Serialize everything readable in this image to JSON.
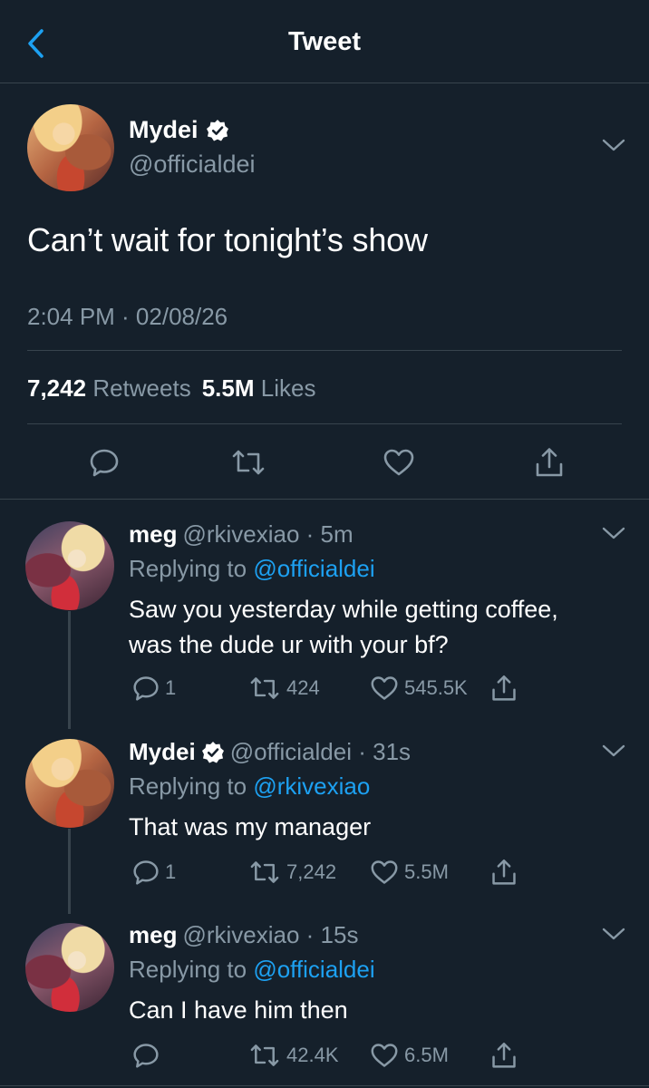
{
  "header": {
    "title": "Tweet"
  },
  "main_tweet": {
    "name": "Mydei",
    "handle": "@officialdei",
    "text": "Can’t wait for tonight’s show",
    "timestamp": "2:04 PM · 02/08/26",
    "retweets_count": "7,242",
    "retweets_label": "Retweets",
    "likes_count": "5.5M",
    "likes_label": "Likes"
  },
  "replies": [
    {
      "name": "meg",
      "meta": "@rkivexiao · 5m",
      "replying_prefix": "Replying to",
      "replying_to": "@officialdei",
      "text_lines": [
        "Saw you yesterday while getting coffee,",
        "was the dude ur with your bf?"
      ],
      "reply_count": "1",
      "retweet_count": "424",
      "like_count": "545.5K"
    },
    {
      "name": "Mydei",
      "meta": "@officialdei · 31s",
      "replying_prefix": "Replying to",
      "replying_to": "@rkivexiao",
      "text_lines": [
        "That was my manager"
      ],
      "reply_count": "1",
      "retweet_count": "7,242",
      "like_count": "5.5M"
    },
    {
      "name": "meg",
      "meta": "@rkivexiao · 15s",
      "replying_prefix": "Replying to",
      "replying_to": "@officialdei",
      "text_lines": [
        "Can I have him then"
      ],
      "reply_count": "",
      "retweet_count": "42.4K",
      "like_count": "6.5M"
    }
  ],
  "colors": {
    "background": "#15202b",
    "secondary_text": "#8899a6",
    "accent": "#1da1f2",
    "divider": "#38444d"
  },
  "icons": [
    "back-chevron-icon",
    "verified-badge-icon",
    "chevron-down-icon",
    "reply-icon",
    "retweet-icon",
    "like-icon",
    "share-icon"
  ]
}
